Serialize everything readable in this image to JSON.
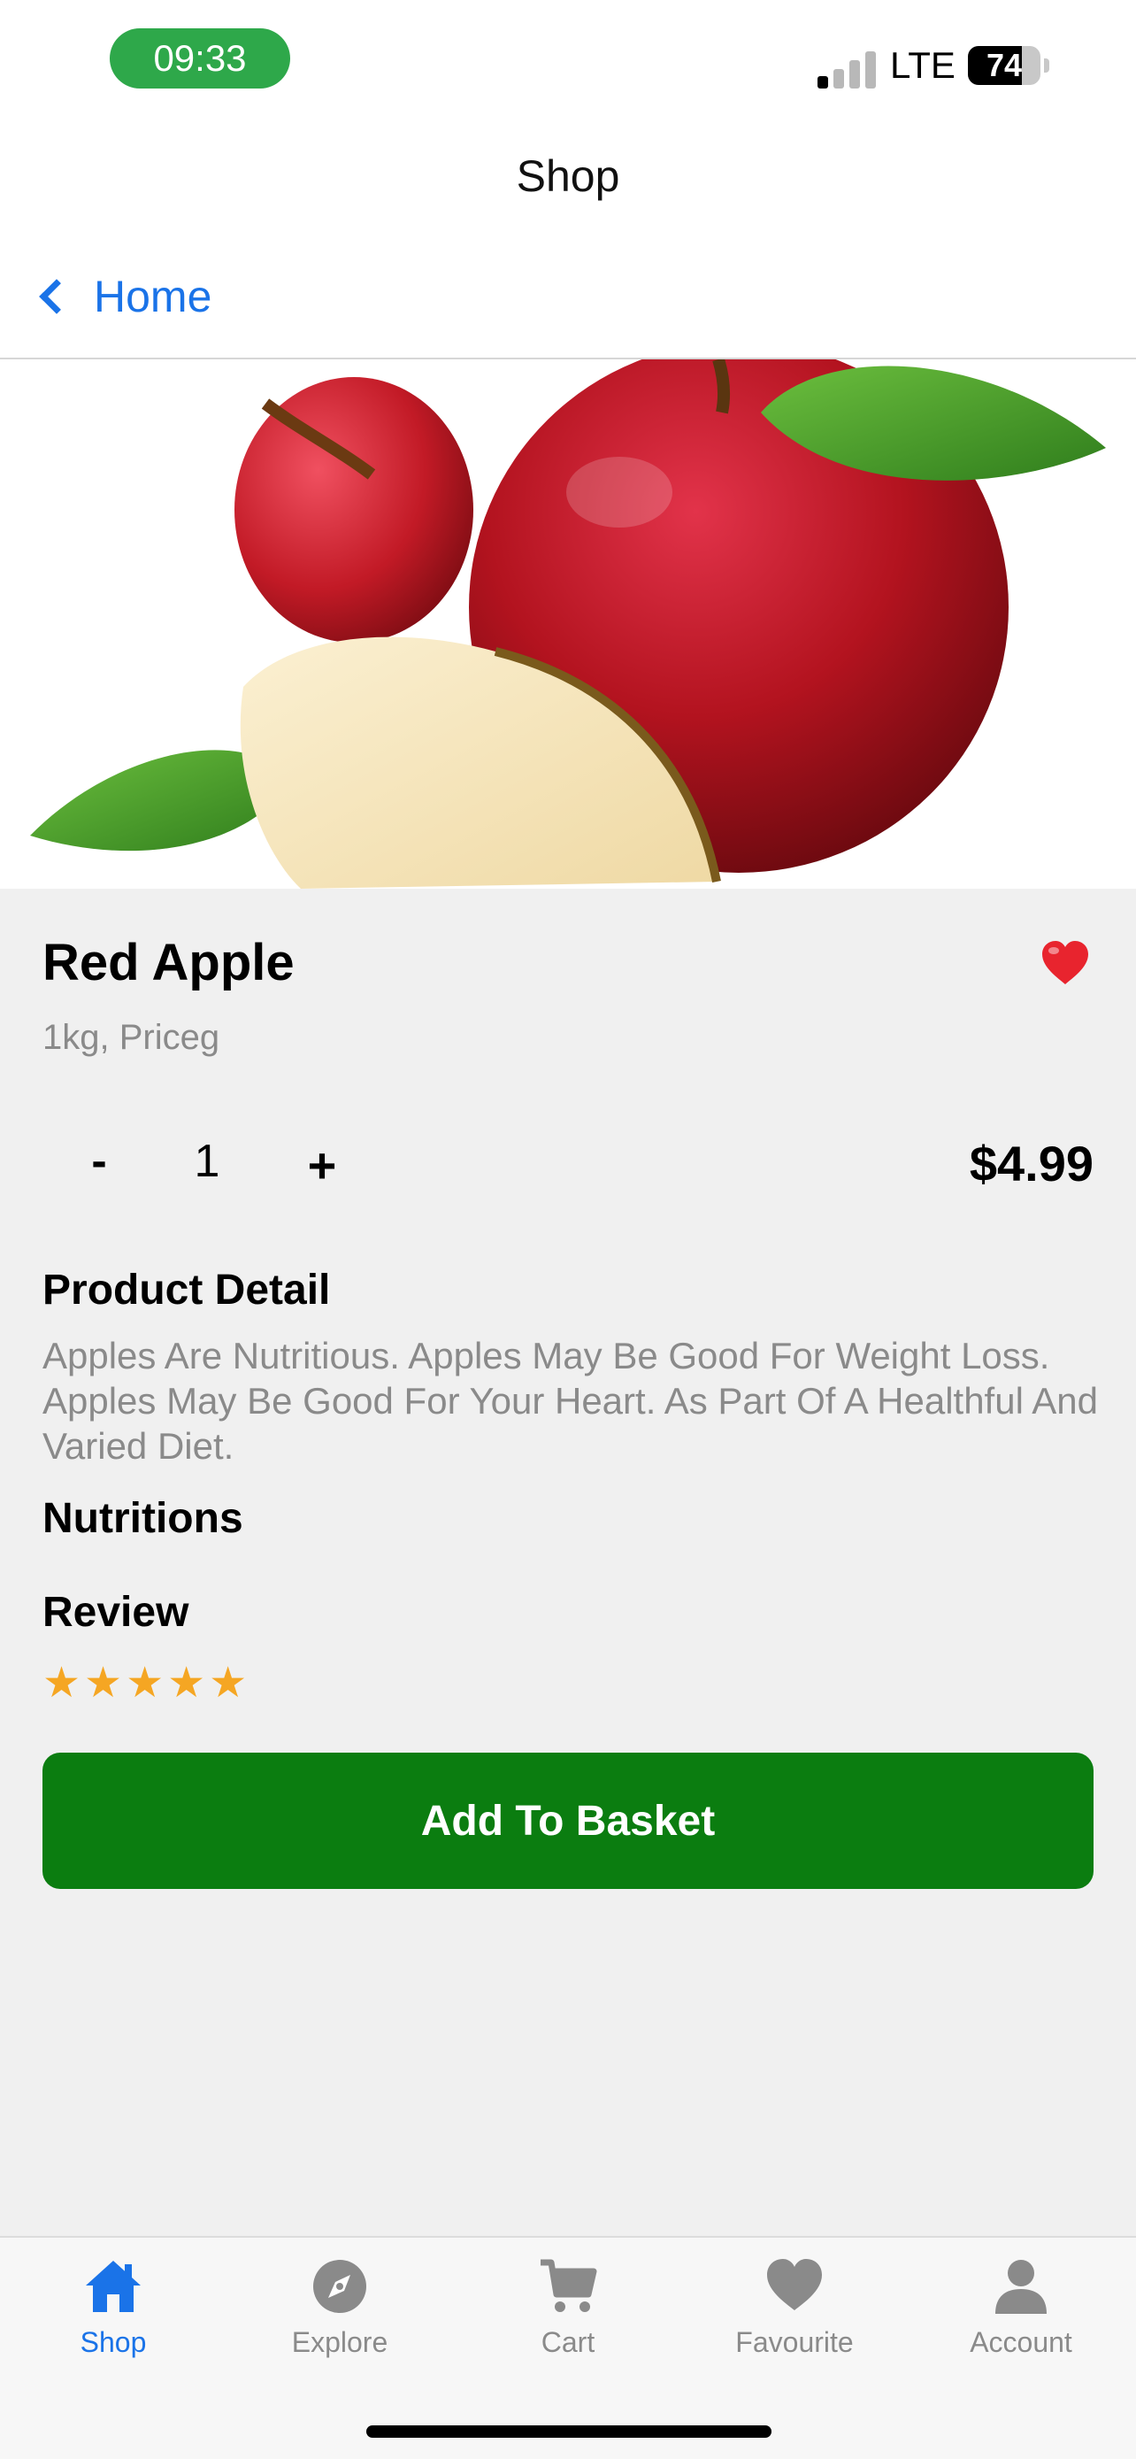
{
  "status": {
    "time": "09:33",
    "network": "LTE",
    "battery_level": "74",
    "battery_fraction": 0.74,
    "signal_bars": 1
  },
  "nav": {
    "title": "Shop",
    "back_label": "Home"
  },
  "product": {
    "name": "Red Apple",
    "subtitle": "1kg, Priceg",
    "quantity": "1",
    "minus_label": "-",
    "plus_label": "+",
    "price": "$4.99",
    "favorite": true
  },
  "sections": {
    "detail_heading": "Product Detail",
    "detail_text": "Apples Are Nutritious. Apples May Be Good For Weight Loss. Apples May Be Good For Your Heart. As Part Of A Healthful And Varied Diet.",
    "nutrition_heading": "Nutritions",
    "review_heading": "Review",
    "rating": 5,
    "star_glyph": "★"
  },
  "actions": {
    "add_to_basket": "Add To Basket"
  },
  "tabs": [
    {
      "label": "Shop",
      "icon": "house-icon",
      "active": true
    },
    {
      "label": "Explore",
      "icon": "compass-icon",
      "active": false
    },
    {
      "label": "Cart",
      "icon": "cart-icon",
      "active": false
    },
    {
      "label": "Favourite",
      "icon": "heart-icon",
      "active": false
    },
    {
      "label": "Account",
      "icon": "person-icon",
      "active": false
    }
  ],
  "colors": {
    "accent": "#1a73e8",
    "primary_button": "#0b7d10",
    "star": "#f5a623",
    "heart": "#e8242e",
    "time_pill": "#2ea84a"
  }
}
